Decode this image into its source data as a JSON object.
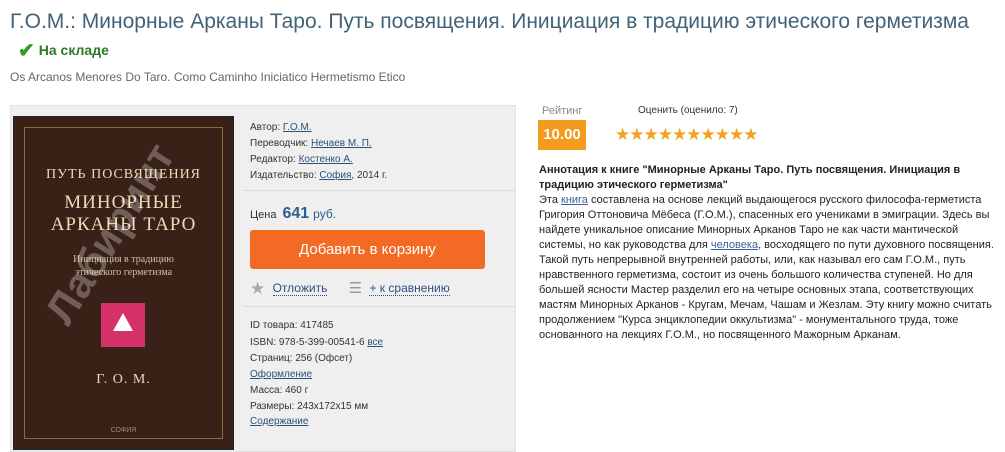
{
  "title": "Г.О.М.: Минорные Арканы Таро. Путь посвящения. Инициация в традицию этического герметизма",
  "stock": "На складе",
  "original_title": "Os Arcanos Menores Do Taro. Como Caminho Iniciatico Hermetismo Etico",
  "cover": {
    "top": "ПУТЬ ПОСВЯЩЕНИЯ",
    "title1": "МИНОРНЫЕ",
    "title2": "АРКАНЫ ТАРО",
    "sub1": "Инициация в традицию",
    "sub2": "этического герметизма",
    "author": "Г. О. М.",
    "publisher": "СОФИЯ",
    "watermark": "Лабиринт"
  },
  "details": {
    "author_label": "Автор:",
    "author": "Г.О.М.",
    "translator_label": "Переводчик:",
    "translator": "Нечаев М. П.",
    "editor_label": "Редактор:",
    "editor": "Костенко А.",
    "publisher_label": "Издательство:",
    "publisher": "София",
    "year": ", 2014 г."
  },
  "price": {
    "label": "Цена",
    "amount": "641",
    "currency": "руб."
  },
  "cart_button": "Добавить в корзину",
  "actions": {
    "postpone": "Отложить",
    "compare": "+ к сравнению"
  },
  "specs": {
    "id": "ID товара: 417485",
    "isbn_label": "ISBN: 978-5-399-00541-6",
    "isbn_all": "все",
    "pages": "Страниц: 256 (Офсет)",
    "design": "Оформление",
    "mass": "Масса: 460 г",
    "size": "Размеры: 243x172x15 мм",
    "contents": "Содержание"
  },
  "rating": {
    "label": "Рейтинг",
    "value": "10.00",
    "rate_label": "Оценить (оценило: 7)",
    "stars": 10
  },
  "annotation": {
    "heading": "Аннотация к книге \"Минорные Арканы Таро. Путь посвящения. Инициация в традицию этического герметизма\"",
    "t1": "Эта ",
    "link1": "книга",
    "t2": " составлена на основе лекций выдающегося русского философа-герметиста Григория Оттоновича Мёбеса (Г.О.М.), спасенных его учениками в эмиграции. Здесь вы найдете уникальное описание Минорных Арканов Таро не как части мантической системы, но как руководства для ",
    "link2": "человека",
    "t3": ", восходящего по пути духовного посвящения. Такой путь непрерывной внутренней работы, или, как называл его сам Г.О.М., путь нравственного герметизма, состоит из очень большого количества ступеней. Но для большей ясности Мастер разделил его на четыре основных этапа, соответствующих мастям Минорных Арканов - Кругам, Мечам, Чашам и Жезлам. Эту книгу можно считать продолжением \"Курса энциклопедии оккультизма\" - монументального труда, тоже основанного на лекциях Г.О.М., но посвященного Мажорным Арканам."
  },
  "colors": {
    "accent": "#f36a24",
    "rating_badge": "#f39a1f",
    "stock": "#2f9c25",
    "title": "#426277"
  }
}
